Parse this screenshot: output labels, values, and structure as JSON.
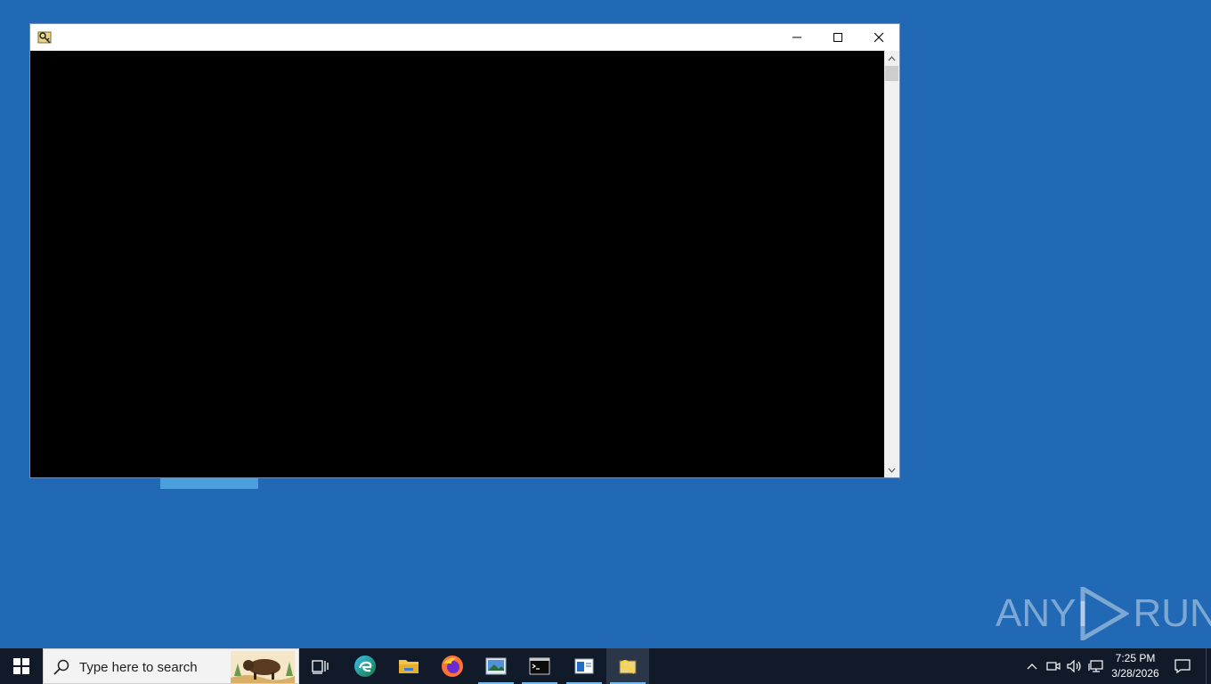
{
  "window": {
    "title": "",
    "icon": "key-folder-app-icon",
    "controls": {
      "minimize": "minimize-icon",
      "maximize": "maximize-icon",
      "close": "close-icon"
    },
    "content_background": "#000000"
  },
  "watermark": {
    "left": "ANY",
    "right": "RUN"
  },
  "taskbar": {
    "search_placeholder": "Type here to search",
    "items": [
      "task-view",
      "edge",
      "file-explorer",
      "firefox",
      "image-viewer",
      "command-prompt",
      "app-window",
      "key-folder-app"
    ],
    "clock": {
      "time": "7:25 PM",
      "date": "3/28/2026"
    }
  },
  "colors": {
    "desktop": "#2169b5",
    "taskbar": "#101a29",
    "accent_underline": "#76b9ed"
  }
}
